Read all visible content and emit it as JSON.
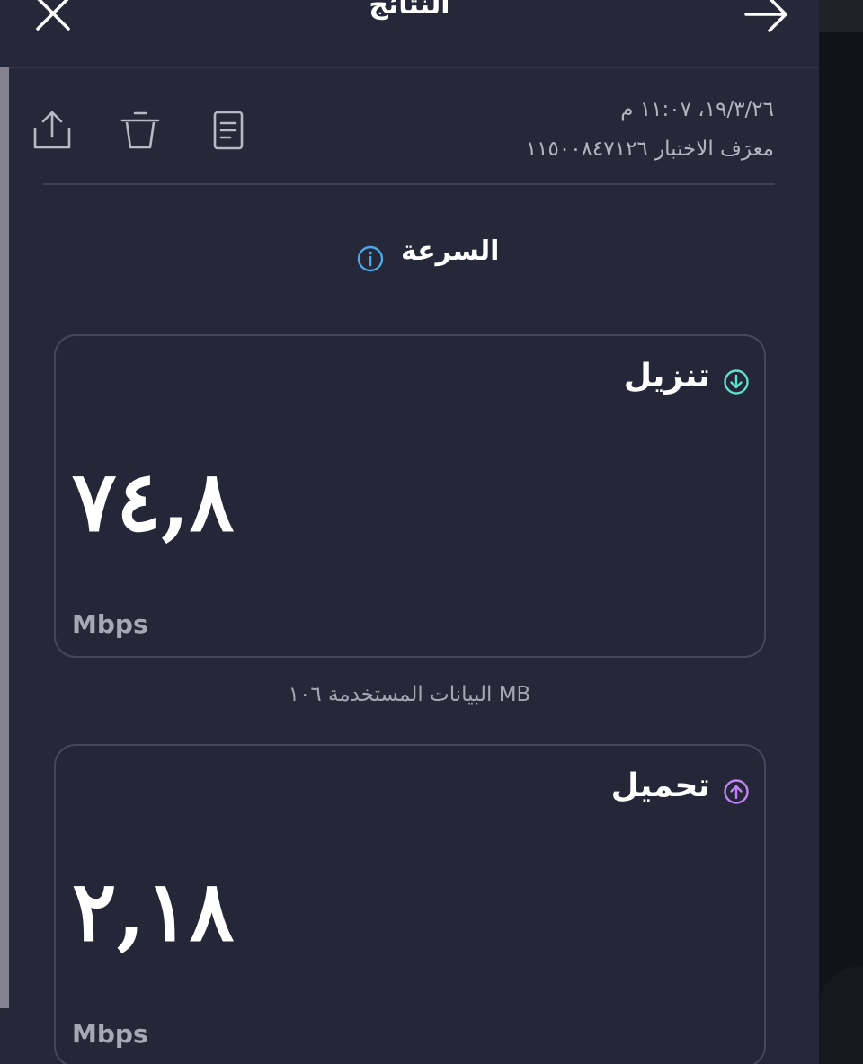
{
  "header": {
    "title": "النتائج",
    "close_icon": "close-icon",
    "back_icon": "arrow-right-icon"
  },
  "meta": {
    "datetime": "١٩/٣/٢٦، ١١:٠٧ م",
    "test_id": "معرَف الاختبار ١١٥٠٠٨٤٧١٢٦"
  },
  "actions": {
    "share_icon": "share-icon",
    "delete_icon": "trash-icon",
    "report_icon": "document-icon"
  },
  "speed": {
    "label": "السرعة",
    "info_icon": "info-icon"
  },
  "download": {
    "label": "تنزيل",
    "value": "٧٤,٨",
    "unit": "Mbps",
    "icon": "arrow-down-circle-icon",
    "color": "#5fe0cd"
  },
  "data_used": "البيانات المستخدمة ١٠٦ MB",
  "upload": {
    "label": "تحميل",
    "value": "٢,١٨",
    "unit": "Mbps",
    "icon": "arrow-up-circle-icon",
    "color": "#c183f5"
  },
  "colors": {
    "background": "#262739",
    "info_accent": "#4aa8e8"
  }
}
